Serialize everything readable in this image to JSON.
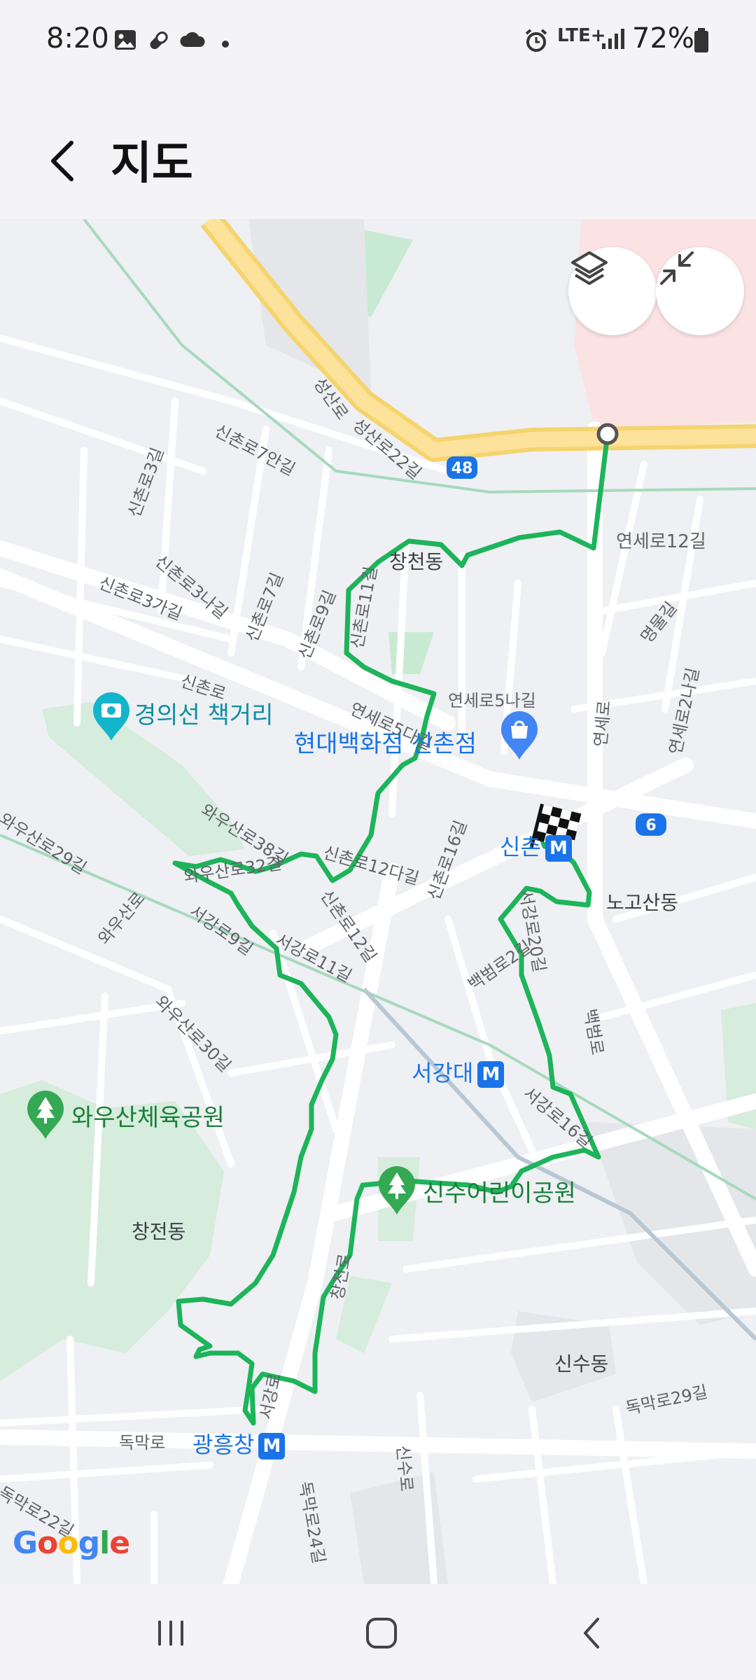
{
  "status_bar": {
    "time": "8:20",
    "network": "LTE+",
    "battery_percent": "72%",
    "icons": [
      "gallery-icon",
      "pill-icon",
      "cloud-icon",
      "dot-icon",
      "alarm-icon",
      "signal-icon",
      "battery-icon"
    ]
  },
  "header": {
    "title": "지도",
    "back_icon": "chevron-left-icon"
  },
  "map": {
    "buttons": [
      {
        "name": "layers-button",
        "icon": "layers-icon"
      },
      {
        "name": "collapse-button",
        "icon": "collapse-arrows-icon"
      }
    ],
    "route_color": "#1db45a",
    "highway_shield": "48",
    "route_shield": "6",
    "labels": {
      "seongsanro": "성산로",
      "seongsanro22": "성산로22길",
      "sinchonro7an": "신촌로7안길",
      "sinchonro3": "신촌로3길",
      "sinchonro3na": "신촌로3나길",
      "sinchonro3ga": "신촌로3가길",
      "sinchonro7": "신촌로7길",
      "sinchonro9": "신촌로9길",
      "sinchonro11": "신촌로11길",
      "changcheondong_top": "창천동",
      "yonseiro12": "연세로12길",
      "myeongmulgil": "명물길",
      "yonseiro2na": "연세로2나길",
      "sinchonro": "신촌로",
      "yonseiro5da": "연세로5다길",
      "yonseiro5na": "연세로5나길",
      "yonseiro": "연세로",
      "wausanro38": "와우산로38길",
      "wausanro29": "와우산로29길",
      "wausanro32": "와우산로32길",
      "sinchonro12da": "신촌로12다길",
      "sinchonro16": "신촌로16길",
      "sinchonro12": "신촌로12길",
      "nogosandong": "노고산동",
      "wausanro": "와우산로",
      "seogangro9": "서강로9길",
      "seogangro11": "서강로11길",
      "seogangro20": "서강로20길",
      "baekbeomro2": "백범로2길",
      "wausanro30": "와우산로30길",
      "baekbeomro": "백범로",
      "seogangro16": "서강로16길",
      "changcheondong_bottom": "창전동",
      "changjeonro": "창전로",
      "sinsudong": "신수동",
      "dongmakro29": "독막로29길",
      "dongmakro": "독막로",
      "seogangro": "서강로",
      "sinsuro": "신수로",
      "dongmakro22": "독막로22길",
      "dongmakro24": "독막로24길"
    },
    "pois": {
      "book_street": "경의선 책거리",
      "hyundai_dept": "현대백화점 신촌점",
      "wausan_park": "와우산체육공원",
      "sinsu_park": "신수어린이공원"
    },
    "stations": {
      "sinchon": "신촌",
      "sogang": "서강대",
      "gwangheungchang": "광흥창"
    },
    "metro_badge": "M",
    "attribution": "Google"
  },
  "nav_bar": {
    "recent": "recent-apps-icon",
    "home": "home-icon",
    "back": "back-icon"
  }
}
